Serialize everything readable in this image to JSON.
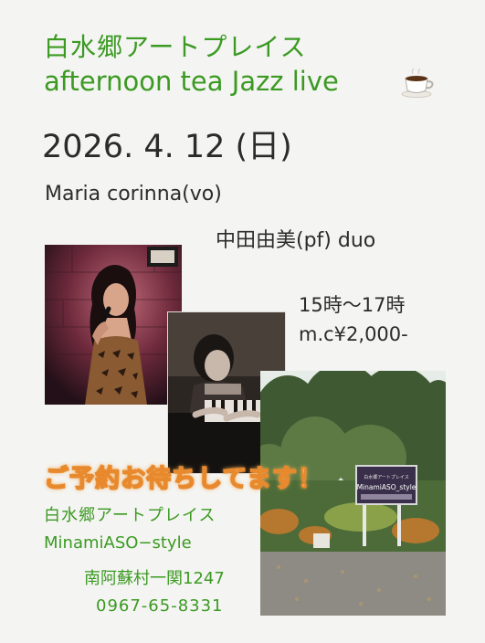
{
  "header": {
    "venue_title": "白水郷アートプレイス",
    "event_title": "afternoon tea Jazz live"
  },
  "event": {
    "date": "2026. 4. 12 (日)",
    "performer1": "Maria corinna(vo)",
    "performer2": "中田由美(pf)   duo",
    "time": "15時〜17時",
    "price": "m.c¥2,000-"
  },
  "reserve_message": "ご予約お待ちしてます！",
  "venue": {
    "name_jp": "白水郷アートプレイス",
    "name_en": "MinamiASO−style",
    "address": "南阿蘇村一関1247",
    "phone": "0967-65-8331",
    "sign_text": "MinamiASO_style"
  },
  "colors": {
    "green_text": "#3b9a22",
    "dark_text": "#2b2b2b",
    "reserve_outline": "#e8892e",
    "background": "#f4f4f2"
  },
  "icons": {
    "title_decoration": "coffee-cup-icon"
  }
}
